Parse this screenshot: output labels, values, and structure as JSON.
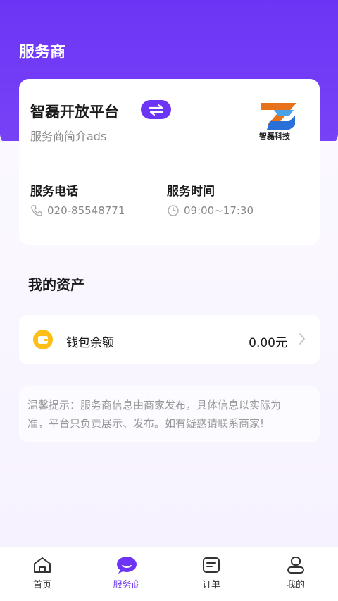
{
  "header": {
    "title": "服务商"
  },
  "provider": {
    "name": "智磊开放平台",
    "description": "服务商简介ads",
    "logo_text": "智磊科技"
  },
  "contact": {
    "phone_label": "服务电话",
    "phone_value": "020-85548771",
    "hours_label": "服务时间",
    "hours_value": "09:00~17:30"
  },
  "assets": {
    "title": "我的资产",
    "wallet_label": "钱包余额",
    "wallet_amount": "0.00元"
  },
  "tip": {
    "line1": "温馨提示：服务商信息由商家发布，具体信息以实际为",
    "line2": "准，平台只负责展示、发布。如有疑惑请联系商家!"
  },
  "tabs": [
    {
      "label": "首页",
      "icon": "home-icon"
    },
    {
      "label": "服务商",
      "icon": "chat-bubble-icon"
    },
    {
      "label": "订单",
      "icon": "order-icon"
    },
    {
      "label": "我的",
      "icon": "profile-icon"
    }
  ],
  "colors": {
    "accent": "#6c35f5",
    "wallet": "#fbbf17"
  }
}
